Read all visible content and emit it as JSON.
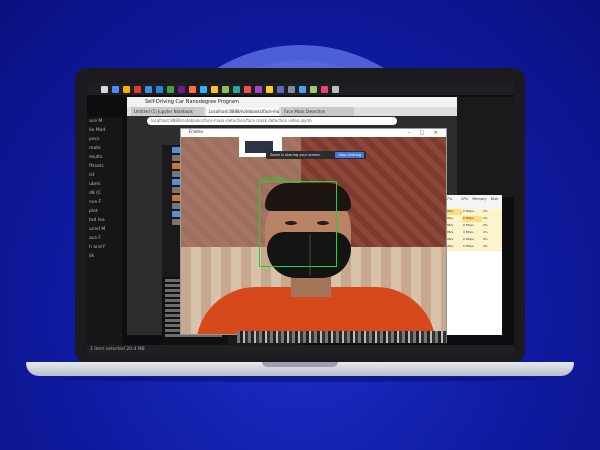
{
  "browser": {
    "window_title": "Self-Driving Car Nanodegree Program",
    "tabs": [
      "Untitled (1) Jupyter Notebook",
      "Localhost:8888/notebooks/face-mask...",
      "Face Mask Detection"
    ],
    "address": "localhost:8888/notebooks/face-mask-detection/face mask detection video.ipynb"
  },
  "left_panel": {
    "items": [
      "ace M",
      "ile  Mod",
      "pecs",
      "reate",
      "esults",
      "ffssets",
      "ist",
      "ubmi",
      "d8 (C",
      "nce F",
      "plot",
      "ted lea",
      "uced M",
      "ace F",
      "h and F",
      "ilk"
    ]
  },
  "camera_window": {
    "title": "Frame",
    "detection_label": "mask 97.40%",
    "sharing_notice": "Zoom is sharing your screen",
    "stop_label": "Stop Sharing"
  },
  "task_manager": {
    "headers": [
      "7%",
      "CPU",
      "Memory",
      "Disk"
    ],
    "rows": [
      [
        "0 MB/s",
        "0 Mbps",
        "0%"
      ],
      [
        "0 MB/s",
        "0 Mbps",
        "0%"
      ],
      [
        "0 MB/s",
        "0 Mbps",
        "0%"
      ],
      [
        "0 MB/s",
        "0 Mbps",
        "0%"
      ],
      [
        "0 MB/s",
        "0 Mbps",
        "0%"
      ],
      [
        "0 MB/s",
        "0 Mbps",
        "0%"
      ]
    ]
  },
  "status_bar": {
    "text": "1 item selected  20.4 MB"
  },
  "colors": {
    "background": "#0f1aa0",
    "detection_box": "#19d62b",
    "shirt": "#d6491a"
  }
}
